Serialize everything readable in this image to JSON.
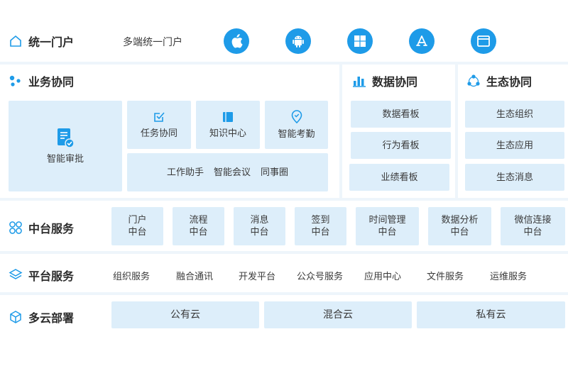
{
  "portal": {
    "title": "统一门户",
    "subtitle": "多端统一门户",
    "icons": [
      "apple-icon",
      "android-icon",
      "windows-icon",
      "app-store-icon",
      "browser-icon"
    ]
  },
  "business": {
    "title": "业务协同",
    "approval": "智能审批",
    "task": "任务协同",
    "knowledge": "知识中心",
    "attendance": "智能考勤",
    "assistant": "工作助手",
    "meeting": "智能会议",
    "circle": "同事圈"
  },
  "data": {
    "title": "数据协同",
    "items": [
      "数据看板",
      "行为看板",
      "业绩看板"
    ]
  },
  "eco": {
    "title": "生态协同",
    "items": [
      "生态组织",
      "生态应用",
      "生态消息"
    ]
  },
  "middle": {
    "title": "中台服务",
    "items": [
      {
        "l1": "门户",
        "l2": "中台"
      },
      {
        "l1": "流程",
        "l2": "中台"
      },
      {
        "l1": "消息",
        "l2": "中台"
      },
      {
        "l1": "签到",
        "l2": "中台"
      },
      {
        "l1": "时间管理",
        "l2": "中台"
      },
      {
        "l1": "数据分析",
        "l2": "中台"
      },
      {
        "l1": "微信连接",
        "l2": "中台"
      }
    ]
  },
  "platform": {
    "title": "平台服务",
    "items": [
      "组织服务",
      "融合通讯",
      "开发平台",
      "公众号服务",
      "应用中心",
      "文件服务",
      "运维服务"
    ]
  },
  "cloud": {
    "title": "多云部署",
    "items": [
      "公有云",
      "混合云",
      "私有云"
    ]
  },
  "colors": {
    "accent": "#1e9be8",
    "tile": "#ddeefa",
    "separator": "#eef5fb"
  }
}
